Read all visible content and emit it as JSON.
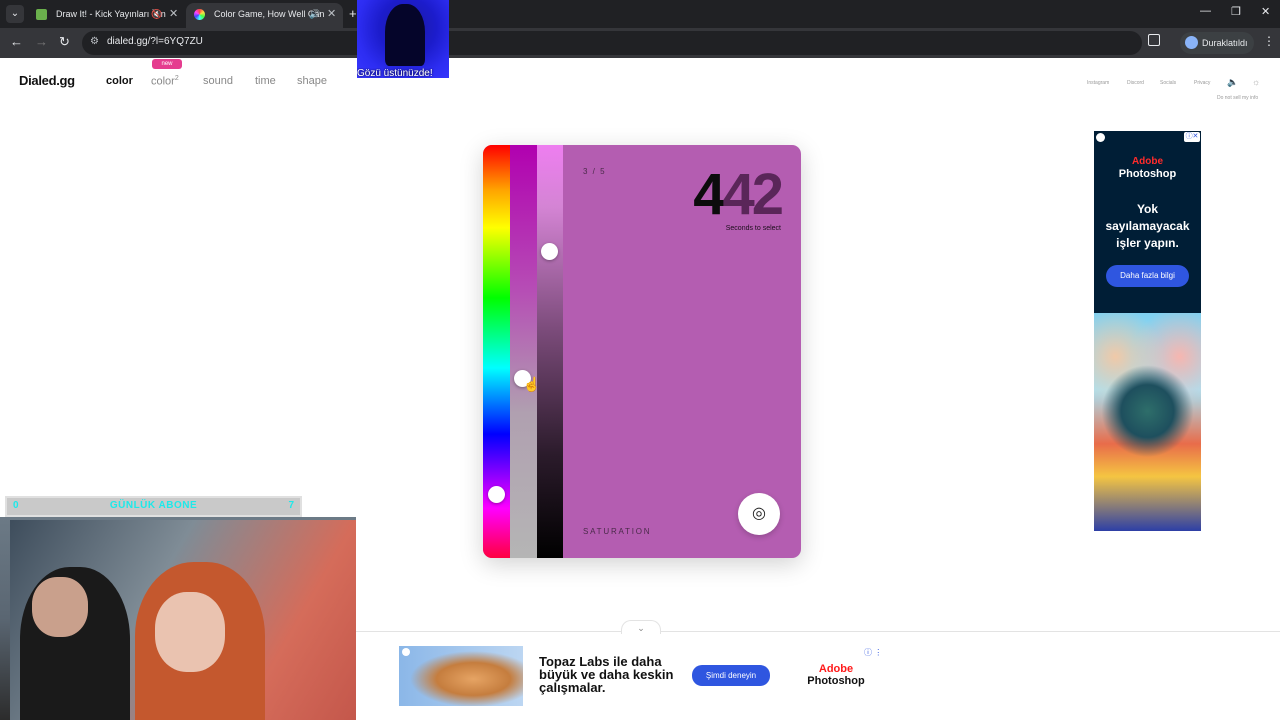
{
  "browser": {
    "tabs": [
      {
        "title": "Draw It! - Kick Yayınları İçin",
        "active": false
      },
      {
        "title": "Color Game, How Well Can",
        "active": true
      }
    ],
    "url": "dialed.gg/?l=6YQ7ZU",
    "paused_label": "Duraklatıldı"
  },
  "site": {
    "logo": "Dialed.gg",
    "nav": [
      "color",
      "color",
      "sound",
      "time",
      "shape"
    ],
    "nav_color2_sup": "2",
    "new_badge": "new",
    "top_links": [
      "Instagram",
      "Discord",
      "Socials",
      "Privacy"
    ],
    "do_not_sell": "Do not sell my info"
  },
  "game": {
    "round": "3 / 5",
    "timer_main": "4",
    "timer_fade": "42",
    "timer_label": "Seconds to select",
    "phase": "SATURATION",
    "color": "#b45db1"
  },
  "ad_right": {
    "brand": "Adobe",
    "product": "Photoshop",
    "slogan": "Yok sayılamayacak işler yapın.",
    "cta": "Daha fazla bilgi"
  },
  "ad_bottom": {
    "headline": "Topaz Labs ile daha büyük ve daha keskin çalışmalar.",
    "cta": "Şimdi deneyin",
    "brand": "Adobe",
    "product": "Photoshop"
  },
  "stream": {
    "overlay_text": "Gözü üstünüzde!",
    "sub_left": "0",
    "sub_label": "GÜNLÜK ABONE",
    "sub_right": "7"
  }
}
